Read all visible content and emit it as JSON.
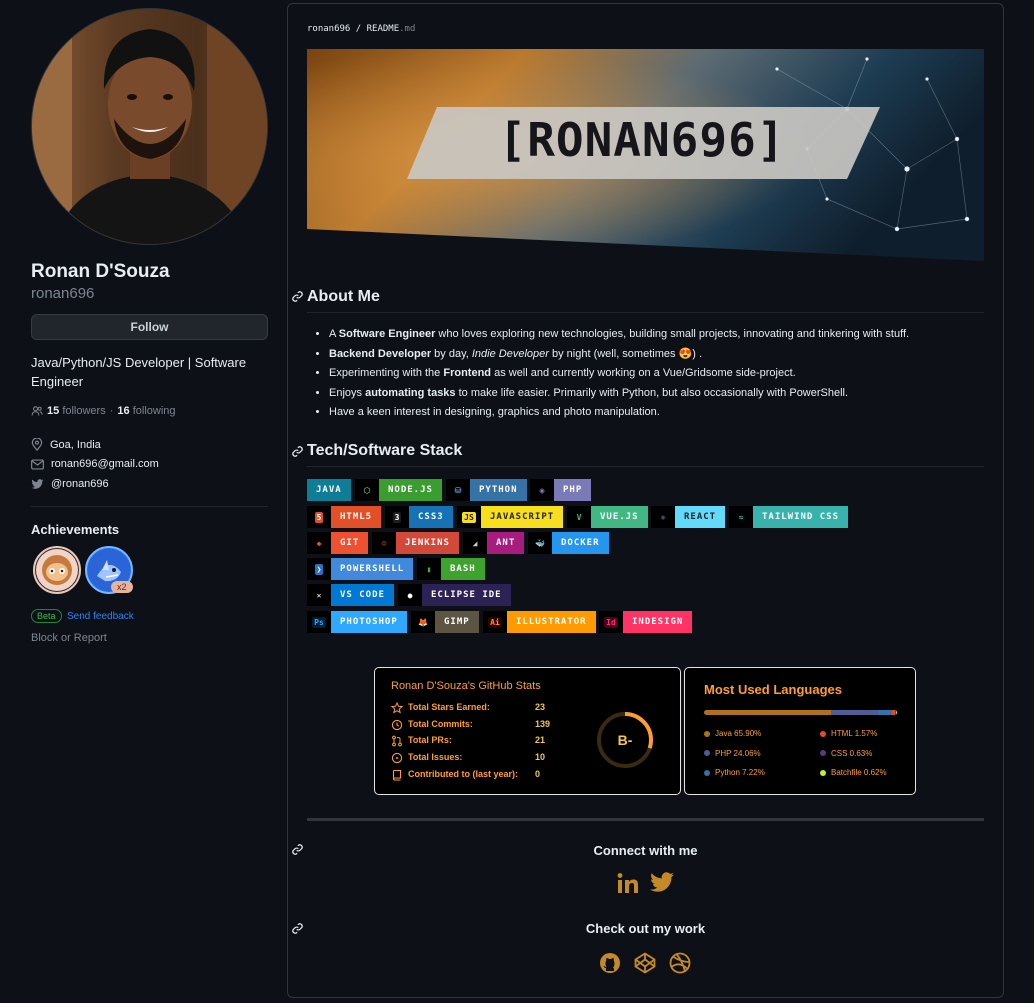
{
  "profile": {
    "name": "Ronan D'Souza",
    "login": "ronan696",
    "follow_label": "Follow",
    "bio": "Java/Python/JS Developer | Software Engineer",
    "followers_count": "15",
    "followers_label": "followers",
    "following_count": "16",
    "following_label": "following",
    "location": "Goa, India",
    "email": "ronan696@gmail.com",
    "twitter": "@ronan696",
    "achievements_title": "Achievements",
    "badge_multiplier": "x2",
    "beta_label": "Beta",
    "feedback_label": "Send feedback",
    "block_label": "Block or Report"
  },
  "readme": {
    "owner": "ronan696",
    "filename": "README",
    "extension": ".md",
    "banner_text": "[RONAN696]",
    "about_title": "About Me",
    "about_items": [
      [
        "A ",
        "Software Engineer",
        " who loves exploring new technologies, building small projects, innovating and tinkering with stuff."
      ],
      [
        "",
        "Backend Developer",
        " by day, ",
        "Indie Developer",
        " by night (well, sometimes 😍) ."
      ],
      [
        "Experimenting with the ",
        "Frontend",
        " as well and currently working on a Vue/Gridsome side-project."
      ],
      [
        "Enjoys ",
        "automating tasks",
        " to make life easier. Primarily with Python, but also occasionally with PowerShell."
      ],
      [
        "Have a keen interest in designing, graphics and photo manipulation."
      ]
    ],
    "stack_title": "Tech/Software Stack",
    "stack_rows": [
      [
        {
          "label": "JAVA",
          "bg": "#0e7d96",
          "icon": ""
        },
        {
          "label": "NODE.JS",
          "bg": "#3b9c2f",
          "icon": "⬡",
          "ic": "#5fa04e"
        },
        {
          "label": "PYTHON",
          "bg": "#3572a5",
          "icon": "⛁",
          "ic": "#4b8bbe"
        },
        {
          "label": "PHP",
          "bg": "#7a7ab8",
          "icon": "◉",
          "ic": "#7a7ab8"
        }
      ],
      [
        {
          "label": "HTML5",
          "bg": "#e34f26",
          "icon": "5",
          "ic": "#fff",
          "ibg": "#e34f26"
        },
        {
          "label": "CSS3",
          "bg": "#1572b6",
          "icon": "3",
          "ic": "#fff",
          "ibg": "#1d1d1d"
        },
        {
          "label": "JAVASCRIPT",
          "bg": "#f7df1e",
          "fg": "#222",
          "icon": "JS",
          "ic": "#222",
          "ibg": "#f7df1e"
        },
        {
          "label": "VUE.JS",
          "bg": "#41b883",
          "icon": "V",
          "ic": "#41b883"
        },
        {
          "label": "REACT",
          "bg": "#61dafb",
          "fg": "#222",
          "icon": "⚛",
          "ic": "#61dafb"
        },
        {
          "label": "TAILWIND CSS",
          "bg": "#38b2ac",
          "icon": "≈",
          "ic": "#38b2ac"
        }
      ],
      [
        {
          "label": "GIT",
          "bg": "#f05032",
          "icon": "◆",
          "ic": "#f05032"
        },
        {
          "label": "JENKINS",
          "bg": "#d24939",
          "icon": "☺",
          "ic": "#d24939"
        },
        {
          "label": "ANT",
          "bg": "#a81c7d",
          "icon": "◢",
          "ic": "#ccc"
        },
        {
          "label": "DOCKER",
          "bg": "#2496ed",
          "icon": "🐳",
          "ic": "#2496ed"
        }
      ],
      [
        {
          "label": "POWERSHELL",
          "bg": "#4189dd",
          "icon": "❯",
          "ic": "#fff",
          "ibg": "#2f6fc1"
        },
        {
          "label": "BASH",
          "bg": "#3fa22e",
          "icon": "▮",
          "ic": "#4eaa25"
        }
      ],
      [
        {
          "label": "VS CODE",
          "bg": "#0078d4",
          "icon": "✕",
          "ic": "#fff"
        },
        {
          "label": "ECLIPSE IDE",
          "bg": "#2c2255",
          "icon": "●",
          "ic": "#fff"
        }
      ],
      [
        {
          "label": "PHOTOSHOP",
          "bg": "#31a8ff",
          "icon": "Ps",
          "ic": "#31a8ff",
          "ibg": "#001e36"
        },
        {
          "label": "GIMP",
          "bg": "#5c5543",
          "icon": "🦊",
          "ic": "#ccc"
        },
        {
          "label": "ILLUSTRATOR",
          "bg": "#ff9a00",
          "icon": "Ai",
          "ic": "#ff9a00",
          "ibg": "#330000"
        },
        {
          "label": "INDESIGN",
          "bg": "#ff3366",
          "icon": "Id",
          "ic": "#ff3366",
          "ibg": "#49021f"
        }
      ]
    ],
    "connect_title": "Connect with me",
    "work_title": "Check out my work"
  },
  "stats_card": {
    "title": "Ronan D'Souza's GitHub Stats",
    "rows": [
      {
        "label": "Total Stars Earned:",
        "value": "23",
        "icon": "star-icon"
      },
      {
        "label": "Total Commits:",
        "value": "139",
        "icon": "history-icon"
      },
      {
        "label": "Total PRs:",
        "value": "21",
        "icon": "pull-request-icon"
      },
      {
        "label": "Total Issues:",
        "value": "10",
        "icon": "issue-icon"
      },
      {
        "label": "Contributed to (last year):",
        "value": "0",
        "icon": "repo-icon"
      }
    ],
    "rank": "B-",
    "rank_progress": 0.3,
    "accent": "#fe9e30"
  },
  "languages_card": {
    "title": "Most Used Languages",
    "languages": [
      {
        "name": "Java",
        "percent": 65.9,
        "label": "Java 65.90%",
        "color": "#b07219"
      },
      {
        "name": "PHP",
        "percent": 24.06,
        "label": "PHP 24.06%",
        "color": "#4f5d95"
      },
      {
        "name": "Python",
        "percent": 7.22,
        "label": "Python 7.22%",
        "color": "#3572a5"
      },
      {
        "name": "HTML",
        "percent": 1.57,
        "label": "HTML 1.57%",
        "color": "#e34c26"
      },
      {
        "name": "CSS",
        "percent": 0.63,
        "label": "CSS 0.63%",
        "color": "#563d7c"
      },
      {
        "name": "Batchfile",
        "percent": 0.62,
        "label": "Batchfile 0.62%",
        "color": "#c1f12e"
      }
    ]
  }
}
